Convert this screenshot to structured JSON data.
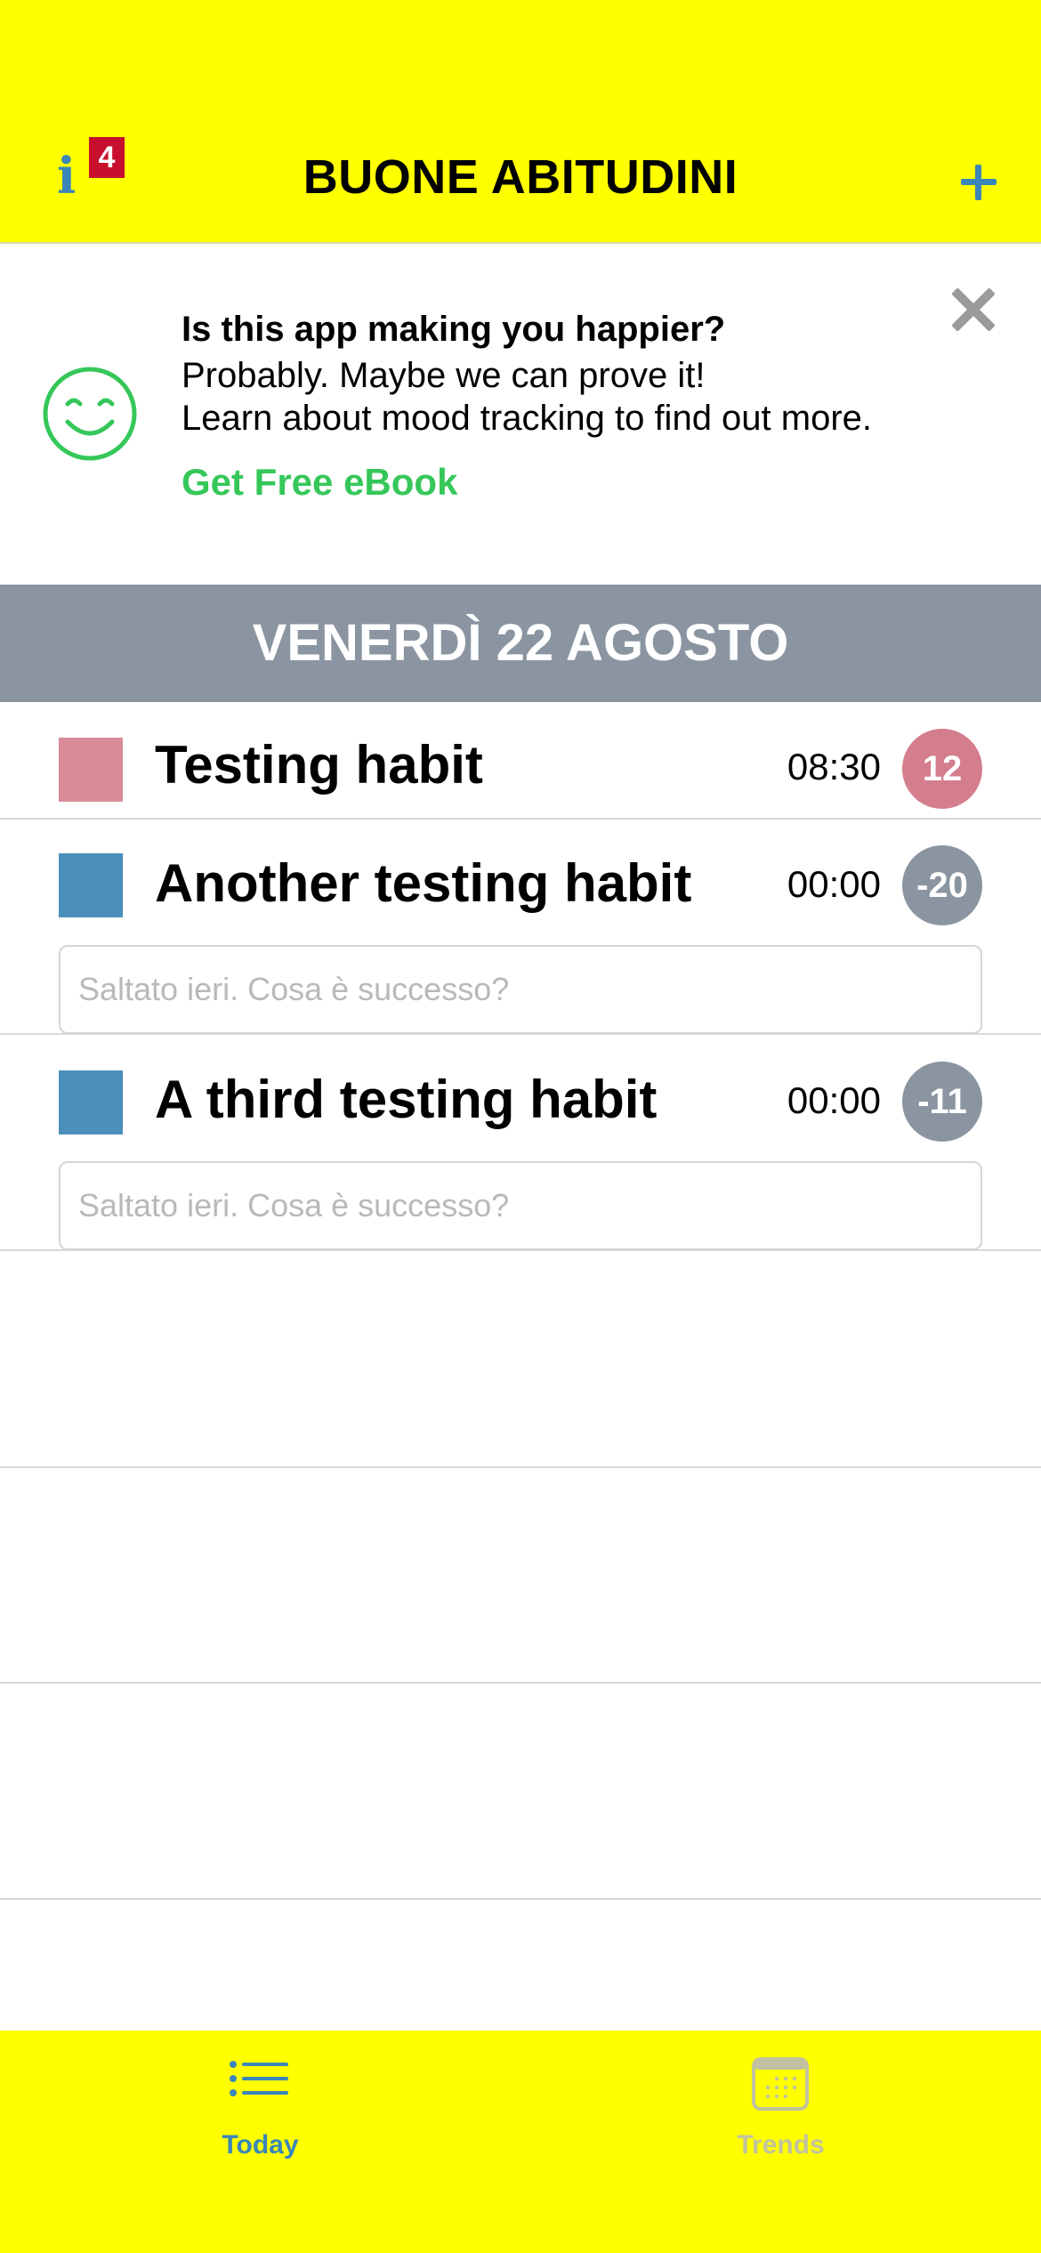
{
  "header": {
    "title": "BUONE ABITUDINI",
    "info_icon_glyph": "i",
    "info_badge_count": "4",
    "add_icon": "plus-icon",
    "background_color": "#ffff00",
    "accent_color": "#3a86b8"
  },
  "promo": {
    "title": "Is this app making you happier?",
    "line1": "Probably. Maybe we can prove it!",
    "line2": "Learn about mood tracking to find out more.",
    "link": "Get Free eBook",
    "icon": "smiley-icon",
    "close_icon": "close-icon",
    "link_color": "#35c759"
  },
  "date_header": "VENERDÌ 22 AGOSTO",
  "habits": [
    {
      "name": "Testing habit",
      "time": "08:30",
      "streak": "12",
      "color": "#d98b98",
      "streak_color": "#d47d8c"
    },
    {
      "name": "Another testing habit",
      "time": "00:00",
      "streak": "-20",
      "color": "#4a90b8",
      "streak_color": "#8a95a1",
      "note_placeholder": "Saltato ieri. Cosa è successo?"
    },
    {
      "name": "A third testing habit",
      "time": "00:00",
      "streak": "-11",
      "color": "#4a90b8",
      "streak_color": "#8a95a1",
      "note_placeholder": "Saltato ieri. Cosa è successo?"
    }
  ],
  "tabbar": {
    "tabs": [
      {
        "label": "Today",
        "icon": "list-icon",
        "active": true
      },
      {
        "label": "Trends",
        "icon": "calendar-icon",
        "active": false
      }
    ]
  }
}
